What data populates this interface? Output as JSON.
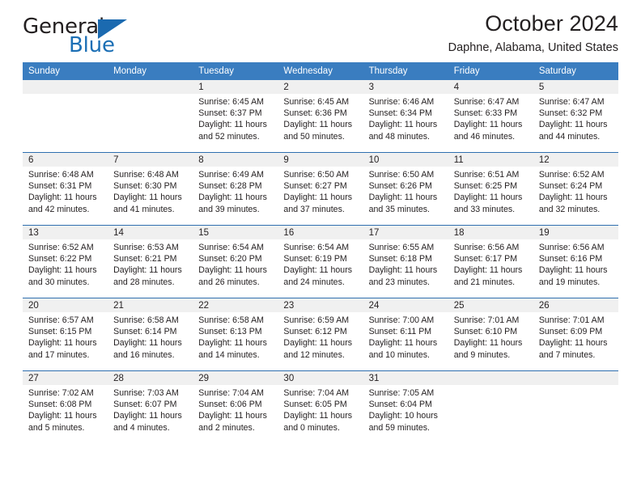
{
  "logo": {
    "word1": "General",
    "word2": "Blue",
    "triangle_color": "#1b6ab0",
    "text_color": "#231f20",
    "blue_color": "#1b6fb5"
  },
  "header": {
    "title": "October 2024",
    "subtitle": "Daphne, Alabama, United States"
  },
  "colors": {
    "header_row_bg": "#3a7dc0",
    "header_row_text": "#ffffff",
    "row_divider": "#2f6fb0",
    "daynum_band": "#f0f0f0",
    "cell_bg": "#ffffff"
  },
  "calendar": {
    "weekday_headers": [
      "Sunday",
      "Monday",
      "Tuesday",
      "Wednesday",
      "Thursday",
      "Friday",
      "Saturday"
    ],
    "weeks": [
      [
        {
          "day": "",
          "lines": []
        },
        {
          "day": "",
          "lines": []
        },
        {
          "day": "1",
          "lines": [
            "Sunrise: 6:45 AM",
            "Sunset: 6:37 PM",
            "Daylight: 11 hours",
            "and 52 minutes."
          ]
        },
        {
          "day": "2",
          "lines": [
            "Sunrise: 6:45 AM",
            "Sunset: 6:36 PM",
            "Daylight: 11 hours",
            "and 50 minutes."
          ]
        },
        {
          "day": "3",
          "lines": [
            "Sunrise: 6:46 AM",
            "Sunset: 6:34 PM",
            "Daylight: 11 hours",
            "and 48 minutes."
          ]
        },
        {
          "day": "4",
          "lines": [
            "Sunrise: 6:47 AM",
            "Sunset: 6:33 PM",
            "Daylight: 11 hours",
            "and 46 minutes."
          ]
        },
        {
          "day": "5",
          "lines": [
            "Sunrise: 6:47 AM",
            "Sunset: 6:32 PM",
            "Daylight: 11 hours",
            "and 44 minutes."
          ]
        }
      ],
      [
        {
          "day": "6",
          "lines": [
            "Sunrise: 6:48 AM",
            "Sunset: 6:31 PM",
            "Daylight: 11 hours",
            "and 42 minutes."
          ]
        },
        {
          "day": "7",
          "lines": [
            "Sunrise: 6:48 AM",
            "Sunset: 6:30 PM",
            "Daylight: 11 hours",
            "and 41 minutes."
          ]
        },
        {
          "day": "8",
          "lines": [
            "Sunrise: 6:49 AM",
            "Sunset: 6:28 PM",
            "Daylight: 11 hours",
            "and 39 minutes."
          ]
        },
        {
          "day": "9",
          "lines": [
            "Sunrise: 6:50 AM",
            "Sunset: 6:27 PM",
            "Daylight: 11 hours",
            "and 37 minutes."
          ]
        },
        {
          "day": "10",
          "lines": [
            "Sunrise: 6:50 AM",
            "Sunset: 6:26 PM",
            "Daylight: 11 hours",
            "and 35 minutes."
          ]
        },
        {
          "day": "11",
          "lines": [
            "Sunrise: 6:51 AM",
            "Sunset: 6:25 PM",
            "Daylight: 11 hours",
            "and 33 minutes."
          ]
        },
        {
          "day": "12",
          "lines": [
            "Sunrise: 6:52 AM",
            "Sunset: 6:24 PM",
            "Daylight: 11 hours",
            "and 32 minutes."
          ]
        }
      ],
      [
        {
          "day": "13",
          "lines": [
            "Sunrise: 6:52 AM",
            "Sunset: 6:22 PM",
            "Daylight: 11 hours",
            "and 30 minutes."
          ]
        },
        {
          "day": "14",
          "lines": [
            "Sunrise: 6:53 AM",
            "Sunset: 6:21 PM",
            "Daylight: 11 hours",
            "and 28 minutes."
          ]
        },
        {
          "day": "15",
          "lines": [
            "Sunrise: 6:54 AM",
            "Sunset: 6:20 PM",
            "Daylight: 11 hours",
            "and 26 minutes."
          ]
        },
        {
          "day": "16",
          "lines": [
            "Sunrise: 6:54 AM",
            "Sunset: 6:19 PM",
            "Daylight: 11 hours",
            "and 24 minutes."
          ]
        },
        {
          "day": "17",
          "lines": [
            "Sunrise: 6:55 AM",
            "Sunset: 6:18 PM",
            "Daylight: 11 hours",
            "and 23 minutes."
          ]
        },
        {
          "day": "18",
          "lines": [
            "Sunrise: 6:56 AM",
            "Sunset: 6:17 PM",
            "Daylight: 11 hours",
            "and 21 minutes."
          ]
        },
        {
          "day": "19",
          "lines": [
            "Sunrise: 6:56 AM",
            "Sunset: 6:16 PM",
            "Daylight: 11 hours",
            "and 19 minutes."
          ]
        }
      ],
      [
        {
          "day": "20",
          "lines": [
            "Sunrise: 6:57 AM",
            "Sunset: 6:15 PM",
            "Daylight: 11 hours",
            "and 17 minutes."
          ]
        },
        {
          "day": "21",
          "lines": [
            "Sunrise: 6:58 AM",
            "Sunset: 6:14 PM",
            "Daylight: 11 hours",
            "and 16 minutes."
          ]
        },
        {
          "day": "22",
          "lines": [
            "Sunrise: 6:58 AM",
            "Sunset: 6:13 PM",
            "Daylight: 11 hours",
            "and 14 minutes."
          ]
        },
        {
          "day": "23",
          "lines": [
            "Sunrise: 6:59 AM",
            "Sunset: 6:12 PM",
            "Daylight: 11 hours",
            "and 12 minutes."
          ]
        },
        {
          "day": "24",
          "lines": [
            "Sunrise: 7:00 AM",
            "Sunset: 6:11 PM",
            "Daylight: 11 hours",
            "and 10 minutes."
          ]
        },
        {
          "day": "25",
          "lines": [
            "Sunrise: 7:01 AM",
            "Sunset: 6:10 PM",
            "Daylight: 11 hours",
            "and 9 minutes."
          ]
        },
        {
          "day": "26",
          "lines": [
            "Sunrise: 7:01 AM",
            "Sunset: 6:09 PM",
            "Daylight: 11 hours",
            "and 7 minutes."
          ]
        }
      ],
      [
        {
          "day": "27",
          "lines": [
            "Sunrise: 7:02 AM",
            "Sunset: 6:08 PM",
            "Daylight: 11 hours",
            "and 5 minutes."
          ]
        },
        {
          "day": "28",
          "lines": [
            "Sunrise: 7:03 AM",
            "Sunset: 6:07 PM",
            "Daylight: 11 hours",
            "and 4 minutes."
          ]
        },
        {
          "day": "29",
          "lines": [
            "Sunrise: 7:04 AM",
            "Sunset: 6:06 PM",
            "Daylight: 11 hours",
            "and 2 minutes."
          ]
        },
        {
          "day": "30",
          "lines": [
            "Sunrise: 7:04 AM",
            "Sunset: 6:05 PM",
            "Daylight: 11 hours",
            "and 0 minutes."
          ]
        },
        {
          "day": "31",
          "lines": [
            "Sunrise: 7:05 AM",
            "Sunset: 6:04 PM",
            "Daylight: 10 hours",
            "and 59 minutes."
          ]
        },
        {
          "day": "",
          "lines": []
        },
        {
          "day": "",
          "lines": []
        }
      ]
    ]
  }
}
